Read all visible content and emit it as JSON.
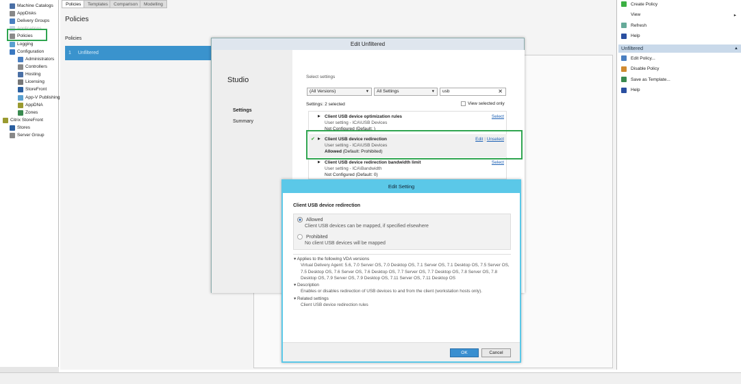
{
  "tree": [
    "Machine Catalogs",
    "AppDisks",
    "Delivery Groups",
    "Applications",
    "Policies",
    "Logging",
    "Configuration",
    "Administrators",
    "Controllers",
    "Hosting",
    "Licensing",
    "StoreFront",
    "App-V Publishing",
    "AppDNA",
    "Zones",
    "Citrix StoreFront",
    "Stores",
    "Server Group"
  ],
  "tabs": [
    "Policies",
    "Templates",
    "Comparison",
    "Modelling"
  ],
  "main": {
    "title": "Policies",
    "section": "Policies",
    "row_num": "1",
    "row_name": "Unfiltered"
  },
  "actions": {
    "top": [
      {
        "label": "Create Policy",
        "icon": "plus-icon"
      },
      {
        "label": "View",
        "icon": ""
      },
      {
        "label": "Refresh",
        "icon": "refresh-icon"
      },
      {
        "label": "Help",
        "icon": "help-icon"
      }
    ],
    "section": "Unfiltered",
    "items": [
      {
        "label": "Edit Policy...",
        "icon": "edit-icon"
      },
      {
        "label": "Disable Policy",
        "icon": "disable-icon"
      },
      {
        "label": "Save as Template...",
        "icon": "save-icon"
      },
      {
        "label": "Help",
        "icon": "help-icon"
      }
    ]
  },
  "edit_dialog": {
    "title": "Edit Unfiltered",
    "brand": "Studio",
    "nav": [
      "Settings",
      "Summary"
    ],
    "select_label": "Select settings",
    "version_filter": "(All Versions)",
    "settings_filter": "All Settings",
    "search": "usb",
    "count": "Settings: 2 selected",
    "view_selected": "View selected only",
    "settings": [
      {
        "name": "Client USB device optimization rules",
        "path": "User setting - ICA\\USB Devices",
        "state": "Not Configured (Default: )",
        "actions": [
          "Select"
        ]
      },
      {
        "name": "Client USB device redirection",
        "path": "User setting - ICA\\USB Devices",
        "state": "Allowed",
        "default": "(Default: Prohibited)",
        "actions": [
          "Edit",
          "Unselect"
        ]
      },
      {
        "name": "Client USB device redirection bandwidth limit",
        "path": "User setting - ICA\\Bandwidth",
        "state": "Not Configured (Default: 0)",
        "actions": [
          "Select"
        ]
      }
    ]
  },
  "edit_setting": {
    "title": "Edit Setting",
    "heading": "Client USB device redirection",
    "options": [
      {
        "label": "Allowed",
        "desc": "Client USB devices can be mapped, if specified elsewhere",
        "checked": true
      },
      {
        "label": "Prohibited",
        "desc": "No client USB devices will be mapped",
        "checked": false
      }
    ],
    "applies_title": "Applies to the following VDA versions",
    "applies": "Virtual Delivery Agent: 5.6, 7.0 Server OS, 7.0 Desktop OS, 7.1 Server OS, 7.1 Desktop OS, 7.5 Server OS, 7.5 Desktop OS, 7.6 Server OS, 7.6 Desktop OS, 7.7 Server OS, 7.7 Desktop OS, 7.8 Server OS, 7.8 Desktop OS, 7.9 Server OS, 7.9 Desktop OS, 7.11 Server OS, 7.11 Desktop OS",
    "desc_title": "Description",
    "desc": "Enables or disables redirection of USB devices to and from the client (workstation hosts only).",
    "related_title": "Related settings",
    "related": "Client USB device redirection rules",
    "ok": "OK",
    "cancel": "Cancel"
  }
}
